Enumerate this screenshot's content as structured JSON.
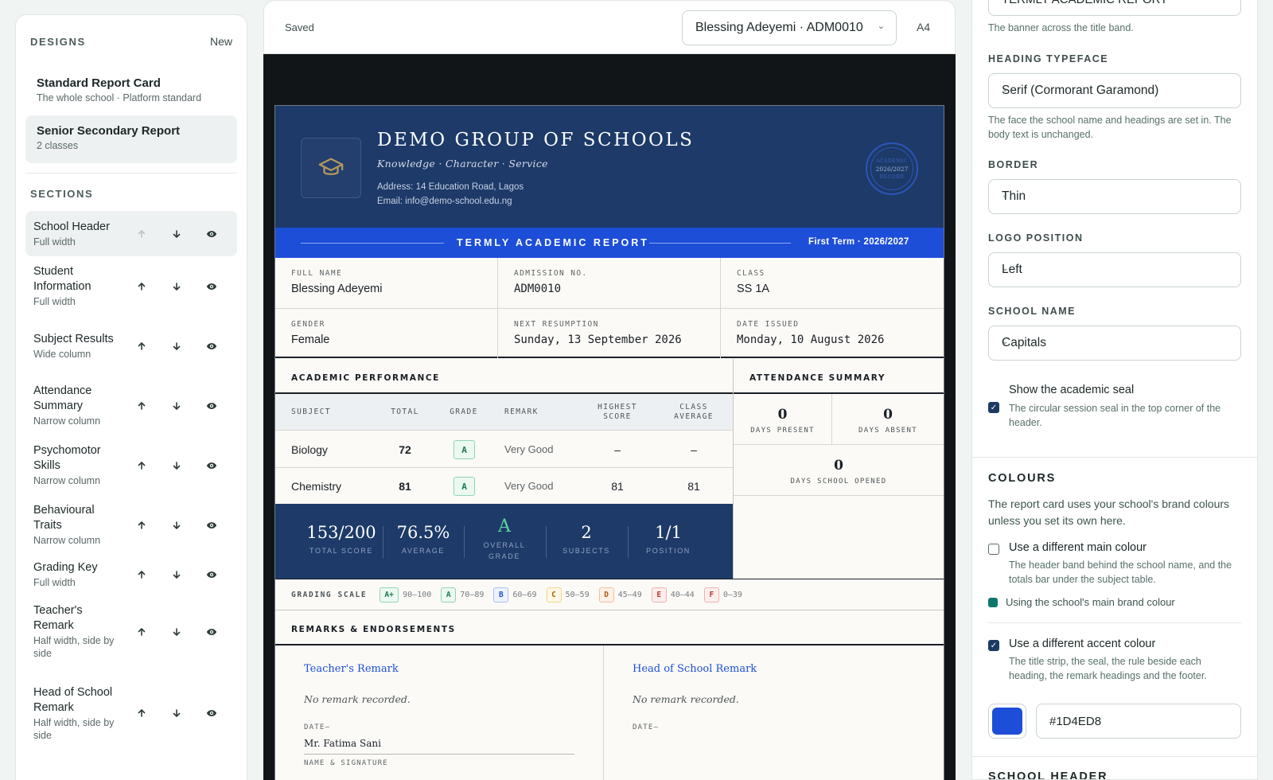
{
  "left_panel": {
    "designs_label": "DESIGNS",
    "new_label": "New",
    "designs": [
      {
        "title": "Standard Report Card",
        "sub": "The whole school · Platform standard"
      },
      {
        "title": "Senior Secondary Report",
        "sub": "2 classes"
      }
    ],
    "sections_label": "SECTIONS",
    "sections": [
      {
        "name": "School Header",
        "width": "Full width"
      },
      {
        "name": "Student Information",
        "width": "Full width"
      },
      {
        "name": "Subject Results",
        "width": "Wide column"
      },
      {
        "name": "Attendance Summary",
        "width": "Narrow column"
      },
      {
        "name": "Psychomotor Skills",
        "width": "Narrow column"
      },
      {
        "name": "Behavioural Traits",
        "width": "Narrow column"
      },
      {
        "name": "Grading Key",
        "width": "Full width"
      },
      {
        "name": "Teacher's Remark",
        "width": "Half width, side by side"
      },
      {
        "name": "Head of School Remark",
        "width": "Half width, side by side"
      }
    ]
  },
  "toolbar": {
    "status": "Saved",
    "student_select": "Blessing Adeyemi · ADM0010",
    "paper_size": "A4"
  },
  "report": {
    "school_name": "DEMO GROUP OF SCHOOLS",
    "motto": "Knowledge · Character · Service",
    "address": "Address: 14 Education Road, Lagos",
    "email": "Email: info@demo-school.edu.ng",
    "seal": {
      "top": "ACADEMIC",
      "mid": "2026/2027",
      "bottom": "RECORD"
    },
    "title": "TERMLY ACADEMIC REPORT",
    "term": "First Term  ·  2026/2027",
    "info": {
      "full_name_label": "FULL NAME",
      "full_name": "Blessing Adeyemi",
      "admission_label": "ADMISSION NO.",
      "admission": "ADM0010",
      "class_label": "CLASS",
      "class": "SS 1A",
      "gender_label": "GENDER",
      "gender": "Female",
      "resumption_label": "NEXT RESUMPTION",
      "resumption": "Sunday, 13 September 2026",
      "issued_label": "DATE ISSUED",
      "issued": "Monday, 10 August 2026"
    },
    "performance": {
      "title": "ACADEMIC PERFORMANCE",
      "headers": {
        "subject": "SUBJECT",
        "total": "TOTAL",
        "grade": "GRADE",
        "remark": "REMARK",
        "highest_1": "HIGHEST",
        "highest_2": "SCORE",
        "avg_1": "CLASS",
        "avg_2": "AVERAGE"
      },
      "rows": [
        {
          "subject": "Biology",
          "total": "72",
          "grade": "A",
          "remark": "Very Good",
          "highest": "–",
          "average": "–"
        },
        {
          "subject": "Chemistry",
          "total": "81",
          "grade": "A",
          "remark": "Very Good",
          "highest": "81",
          "average": "81"
        }
      ],
      "totals": {
        "score": "153/200",
        "score_label": "TOTAL SCORE",
        "average": "76.5%",
        "average_label": "AVERAGE",
        "grade": "A",
        "grade_label_1": "OVERALL",
        "grade_label_2": "GRADE",
        "subjects": "2",
        "subjects_label": "SUBJECTS",
        "position": "1/1",
        "position_label": "POSITION"
      }
    },
    "attendance": {
      "title": "ATTENDANCE SUMMARY",
      "present": "0",
      "present_label": "DAYS PRESENT",
      "absent": "0",
      "absent_label": "DAYS ABSENT",
      "opened": "0",
      "opened_label": "DAYS SCHOOL OPENED"
    },
    "grading": {
      "label": "GRADING SCALE",
      "items": [
        {
          "g": "A+",
          "range": "90–100",
          "fg": "#167c4b",
          "bg": "#ecf9f2",
          "border": "#8fd5b3"
        },
        {
          "g": "A",
          "range": "70–89",
          "fg": "#167c4b",
          "bg": "#ecf9f2",
          "border": "#8fd5b3"
        },
        {
          "g": "B",
          "range": "60–69",
          "fg": "#2454c8",
          "bg": "#edf2ff",
          "border": "#a9bff4"
        },
        {
          "g": "C",
          "range": "50–59",
          "fg": "#9a6b06",
          "bg": "#fff8e5",
          "border": "#f0d58a"
        },
        {
          "g": "D",
          "range": "45–49",
          "fg": "#b5580f",
          "bg": "#fff1e6",
          "border": "#f2c29b"
        },
        {
          "g": "E",
          "range": "40–44",
          "fg": "#c0392b",
          "bg": "#fdeeee",
          "border": "#f1b2aa"
        },
        {
          "g": "F",
          "range": "0–39",
          "fg": "#c0392b",
          "bg": "#fdeeee",
          "border": "#f1b2aa"
        }
      ]
    },
    "remarks": {
      "title": "REMARKS & ENDORSEMENTS",
      "teacher_title": "Teacher's Remark",
      "teacher_body": "No remark recorded.",
      "teacher_date": "DATE—",
      "teacher_sig": "Mr. Fatima Sani",
      "sig_label": "NAME & SIGNATURE",
      "head_title": "Head of School Remark",
      "head_body": "No remark recorded.",
      "head_date": "DATE—"
    }
  },
  "right_panel": {
    "banner_help": "The banner across the title band.",
    "heading_typeface_label": "HEADING TYPEFACE",
    "heading_typeface": "Serif (Cormorant Garamond)",
    "heading_typeface_help": "The face the school name and headings are set in. The body text is unchanged.",
    "border_label": "BORDER",
    "border": "Thin",
    "logo_label": "LOGO POSITION",
    "logo": "Left",
    "school_name_label": "SCHOOL NAME",
    "school_name": "Capitals",
    "seal_label": "Show the academic seal",
    "seal_help": "The circular session seal in the top corner of the header.",
    "colours_title": "COLOURS",
    "colours_help": "The report card uses your school's brand colours unless you set its own here.",
    "main_colour_label": "Use a different main colour",
    "main_colour_help": "The header band behind the school name, and the totals bar under the subject table.",
    "brand_note": "Using the school's main brand colour",
    "accent_label": "Use a different accent colour",
    "accent_help": "The title strip, the seal, the rule beside each heading, the remark headings and the footer.",
    "accent_hex": "#1D4ED8",
    "next_section": "SCHOOL HEADER"
  }
}
